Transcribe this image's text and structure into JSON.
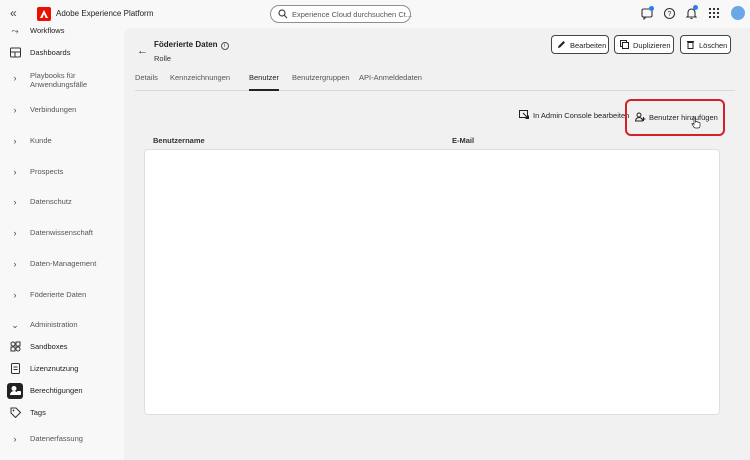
{
  "topbar": {
    "app_title": "Adobe Experience Platform",
    "search_placeholder": "Experience Cloud durchsuchen Ct..."
  },
  "sidebar": {
    "items": [
      {
        "label": "Workflows",
        "icon": "workflow-icon"
      },
      {
        "label": "Dashboards",
        "icon": "dashboard-icon"
      },
      {
        "label": "Playbooks für",
        "label2": "Anwendungsfälle",
        "icon": "chevron-right-icon"
      },
      {
        "label": "Verbindungen",
        "icon": "chevron-right-icon"
      },
      {
        "label": "Kunde",
        "icon": "chevron-right-icon"
      },
      {
        "label": "Prospects",
        "icon": "chevron-right-icon"
      },
      {
        "label": "Datenschutz",
        "icon": "chevron-right-icon"
      },
      {
        "label": "Datenwissenschaft",
        "icon": "chevron-right-icon"
      },
      {
        "label": "Daten-Management",
        "icon": "chevron-right-icon"
      },
      {
        "label": "Föderierte Daten",
        "icon": "chevron-right-icon"
      },
      {
        "label": "Administration",
        "icon": "chevron-down-icon"
      },
      {
        "label": "Sandboxes",
        "icon": "sandbox-icon"
      },
      {
        "label": "Lizenznutzung",
        "icon": "license-icon"
      },
      {
        "label": "Berechtigungen",
        "icon": "permissions-icon",
        "active": true
      },
      {
        "label": "Tags",
        "icon": "tag-icon"
      },
      {
        "label": "Datenerfassung",
        "icon": "chevron-right-icon"
      }
    ]
  },
  "header": {
    "title": "Föderierte Daten",
    "subtitle": "Rolle",
    "edit_label": "Bearbeiten",
    "duplicate_label": "Duplizieren",
    "delete_label": "Löschen"
  },
  "tabs": [
    {
      "label": "Details"
    },
    {
      "label": "Kennzeichnungen"
    },
    {
      "label": "Benutzer",
      "selected": true
    },
    {
      "label": "Benutzergruppen"
    },
    {
      "label": "API-Anmeldedaten"
    }
  ],
  "actions": {
    "admin_console_label": "In Admin Console bearbeiten",
    "add_user_label": "Benutzer hinzufügen"
  },
  "table": {
    "columns": [
      "Benutzername",
      "E-Mail"
    ],
    "rows": []
  },
  "colors": {
    "accent_red": "#d4202a",
    "adobe_red": "#eb1000",
    "notification_blue": "#2680eb"
  }
}
